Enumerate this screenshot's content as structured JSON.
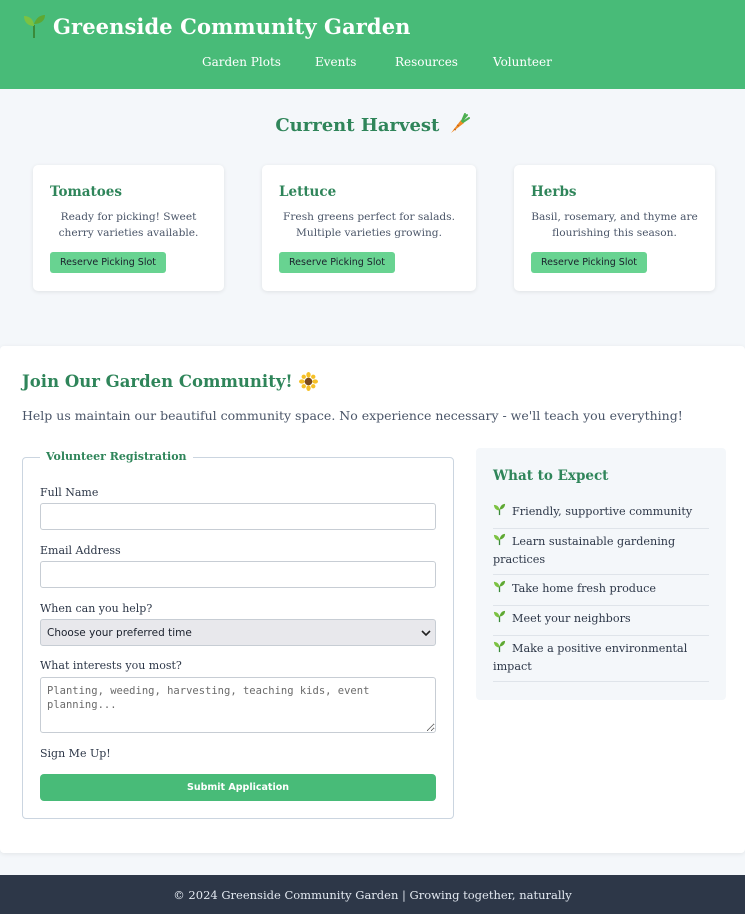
{
  "header": {
    "title": "Greenside Community Garden",
    "nav": [
      "Garden Plots",
      "Events",
      "Resources",
      "Volunteer"
    ]
  },
  "harvest": {
    "title": "Current Harvest",
    "cards": [
      {
        "title": "Tomatoes",
        "description": "Ready for picking! Sweet cherry varieties available.",
        "button": "Reserve Picking Slot"
      },
      {
        "title": "Lettuce",
        "description": "Fresh greens perfect for salads. Multiple varieties growing.",
        "button": "Reserve Picking Slot"
      },
      {
        "title": "Herbs",
        "description": "Basil, rosemary, and thyme are flourishing this season.",
        "button": "Reserve Picking Slot"
      }
    ]
  },
  "join": {
    "title": "Join Our Garden Community!",
    "intro": "Help us maintain our beautiful community space. No experience necessary - we'll teach you everything!",
    "form": {
      "legend": "Volunteer Registration",
      "name_label": "Full Name",
      "name_value": "",
      "email_label": "Email Address",
      "email_value": "",
      "time_label": "When can you help?",
      "time_selected": "Choose your preferred time",
      "interests_label": "What interests you most?",
      "interests_placeholder": "Planting, weeding, harvesting, teaching kids, event planning...",
      "signup_label": "Sign Me Up!",
      "submit": "Submit Application"
    },
    "expect": {
      "title": "What to Expect",
      "items": [
        "Friendly, supportive community",
        "Learn sustainable gardening practices",
        "Take home fresh produce",
        "Meet your neighbors",
        "Make a positive environmental impact"
      ]
    }
  },
  "footer": {
    "text": "© 2024 Greenside Community Garden | Growing together, naturally"
  },
  "colors": {
    "primary": "#48bb78",
    "dark_green": "#2f855a",
    "button_light": "#68d391",
    "footer": "#2d3748"
  },
  "icons": {
    "brand": "seedling-icon",
    "harvest": "carrot-icon",
    "join": "sunflower-icon",
    "list": "seedling-icon"
  }
}
